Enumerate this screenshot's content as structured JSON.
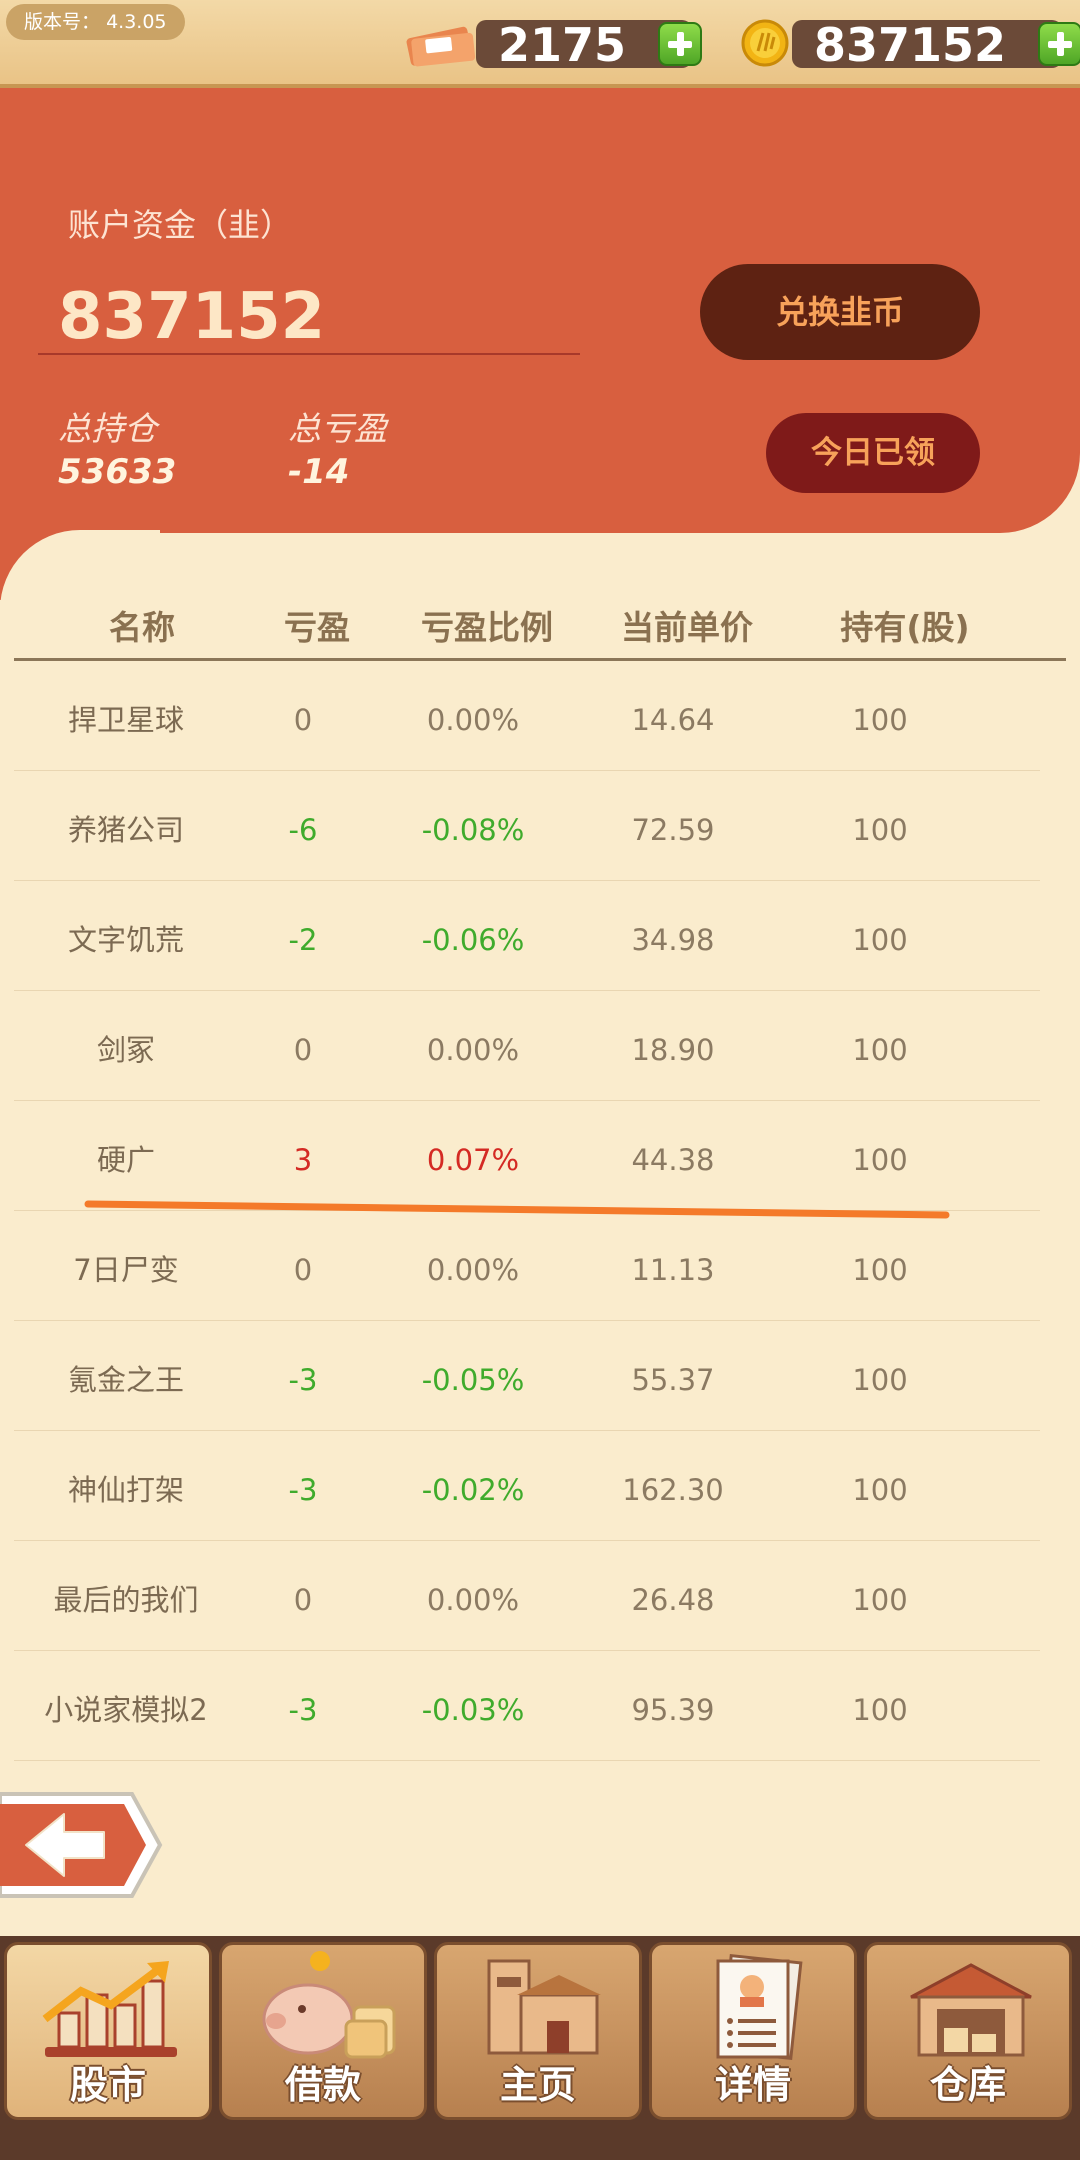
{
  "version": {
    "label": "版本号：",
    "value": "4.3.05"
  },
  "resources": {
    "tickets": "2175",
    "coins": "837152"
  },
  "account": {
    "label": "账户资金（韭）",
    "value": "837152",
    "exchange_button": "兑换韭币",
    "claim_button": "今日已领",
    "total_position_label": "总持仓",
    "total_position_value": "53633",
    "total_pnl_label": "总亏盈",
    "total_pnl_value": "-14"
  },
  "table": {
    "headers": [
      "名称",
      "亏盈",
      "亏盈比例",
      "当前单价",
      "持有(股)"
    ],
    "rows": [
      {
        "name": "捍卫星球",
        "pnl": "0",
        "ratio": "0.00%",
        "price": "14.64",
        "shares": "100"
      },
      {
        "name": "养猪公司",
        "pnl": "-6",
        "ratio": "-0.08%",
        "price": "72.59",
        "shares": "100"
      },
      {
        "name": "文字饥荒",
        "pnl": "-2",
        "ratio": "-0.06%",
        "price": "34.98",
        "shares": "100"
      },
      {
        "name": "剑冢",
        "pnl": "0",
        "ratio": "0.00%",
        "price": "18.90",
        "shares": "100"
      },
      {
        "name": "硬广",
        "pnl": "3",
        "ratio": "0.07%",
        "price": "44.38",
        "shares": "100"
      },
      {
        "name": "7日尸变",
        "pnl": "0",
        "ratio": "0.00%",
        "price": "11.13",
        "shares": "100"
      },
      {
        "name": "氪金之王",
        "pnl": "-3",
        "ratio": "-0.05%",
        "price": "55.37",
        "shares": "100"
      },
      {
        "name": "神仙打架",
        "pnl": "-3",
        "ratio": "-0.02%",
        "price": "162.30",
        "shares": "100"
      },
      {
        "name": "最后的我们",
        "pnl": "0",
        "ratio": "0.00%",
        "price": "26.48",
        "shares": "100"
      },
      {
        "name": "小说家模拟2",
        "pnl": "-3",
        "ratio": "-0.03%",
        "price": "95.39",
        "shares": "100"
      }
    ]
  },
  "nav": {
    "stock": "股市",
    "loan": "借款",
    "home": "主页",
    "details": "详情",
    "warehouse": "仓库"
  },
  "colors": {
    "panel": "#d85f3f",
    "background": "#faeccd",
    "gain": "#d42a24",
    "loss": "#3fab2c",
    "highlight": "#f47a2a"
  }
}
